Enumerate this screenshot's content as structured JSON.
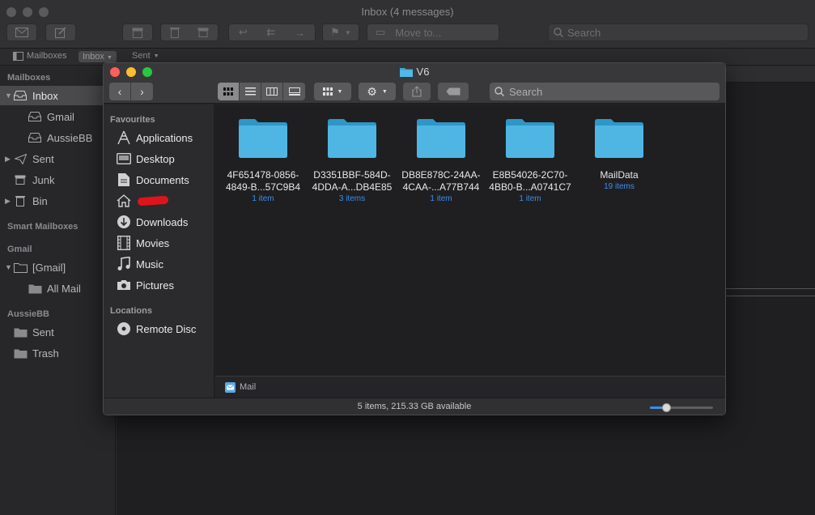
{
  "mail": {
    "title": "Inbox (4 messages)",
    "search_placeholder": "Search",
    "move_to_label": "Move to...",
    "favorites_bar": {
      "mailboxes": "Mailboxes",
      "inbox": "Inbox",
      "sent": "Sent"
    },
    "sidebar": {
      "sections": {
        "mailboxes": "Mailboxes",
        "smart_mailboxes": "Smart Mailboxes",
        "gmail": "Gmail",
        "aussiebb": "AussieBB"
      },
      "items": {
        "inbox": "Inbox",
        "gmail": "Gmail",
        "aussiebb": "AussieBB",
        "sent": "Sent",
        "junk": "Junk",
        "bin": "Bin",
        "gmail_folder": "[Gmail]",
        "all_mail": "All Mail",
        "aussie_sent": "Sent",
        "aussie_trash": "Trash"
      }
    }
  },
  "finder": {
    "title": "V6",
    "search_placeholder": "Search",
    "sidebar": {
      "favourites_header": "Favourites",
      "locations_header": "Locations",
      "favourites": [
        "Applications",
        "Desktop",
        "Documents",
        "",
        "Downloads",
        "Movies",
        "Music",
        "Pictures"
      ],
      "locations": [
        "Remote Disc"
      ]
    },
    "folders": [
      {
        "name": "4F651478-0856-4849-B...57C9B4",
        "count": "1 item"
      },
      {
        "name": "D3351BBF-584D-4DDA-A...DB4E85",
        "count": "3 items"
      },
      {
        "name": "DB8E878C-24AA-4CAA-...A77B744",
        "count": "1 item"
      },
      {
        "name": "E8B54026-2C70-4BB0-B...A0741C7",
        "count": "1 item"
      },
      {
        "name": "MailData",
        "count": "19 items"
      }
    ],
    "path": "Mail",
    "status": "5 items, 215.33 GB available",
    "icon_size_fraction": 0.25
  },
  "colors": {
    "folder": "#3aa8d8",
    "accent_blue": "#3d8ee8",
    "close": "#fe5f57",
    "minimize": "#febc2e",
    "zoom": "#28c840"
  }
}
